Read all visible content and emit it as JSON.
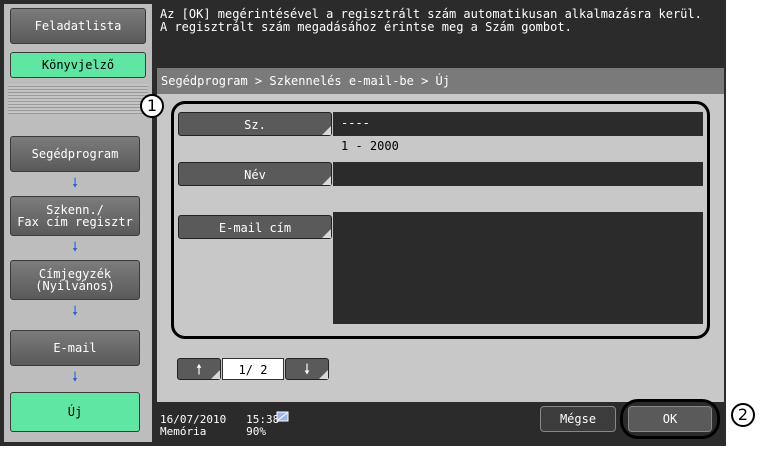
{
  "sidebar": {
    "job_list": "Feladatlista",
    "bookmark": "Könyvjelző",
    "path_steps": [
      "Segédprogram",
      "Szkenn./\nFax cím regisztr",
      "Címjegyzék\n(Nyilvános)",
      "E-mail",
      "Új"
    ],
    "arrow": "🠗"
  },
  "header": {
    "message": "Az [OK] megérintésével a regisztrált szám automatikusan alkalmazásra kerül.\nA regisztrált szám megadásához érintse meg a Szám gombot.",
    "breadcrumb": "Segédprogram > Szkennelés e-mail-be > Új"
  },
  "form": {
    "number_label": "Sz.",
    "number_value": "----",
    "number_range": "1 - 2000",
    "name_label": "Név",
    "name_value": "",
    "email_label": "E-mail cím",
    "email_value": ""
  },
  "pagination": {
    "up_icon": "🠕",
    "down_icon": "🠗",
    "page": "1/ 2"
  },
  "status": {
    "date": "16/07/2010",
    "time": "15:38",
    "memory_label": "Memória",
    "memory_value": "90%",
    "cancel": "Mégse",
    "ok": "OK"
  },
  "callouts": [
    "1",
    "2"
  ]
}
